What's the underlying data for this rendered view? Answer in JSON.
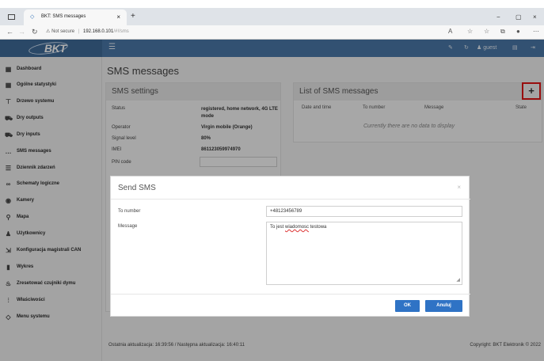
{
  "browser": {
    "tab_title": "BKT: SMS messages",
    "tab_close": "×",
    "new_tab": "+",
    "window_minimize": "−",
    "window_maximize": "▢",
    "window_close": "×",
    "not_secure_label": "Not secure",
    "url_host": "192.168.0.101",
    "url_path": "/#!/sms",
    "url_separator": "|"
  },
  "app": {
    "logo_text": "BKT",
    "user_label": "guest",
    "menu_icon": "☰"
  },
  "sidebar": {
    "items": [
      {
        "label": "Dashboard",
        "icon": "grid-icon"
      },
      {
        "label": "Ogólne statystyki",
        "icon": "grid-icon"
      },
      {
        "label": "Drzewo systemu",
        "icon": "tree-icon"
      },
      {
        "label": "Dry outputs",
        "icon": "car-icon"
      },
      {
        "label": "Dry inputs",
        "icon": "car-icon"
      },
      {
        "label": "SMS messages",
        "icon": "dots-icon"
      },
      {
        "label": "Dziennik zdarzeń",
        "icon": "list-icon"
      },
      {
        "label": "Schematy logiczne",
        "icon": "link-icon"
      },
      {
        "label": "Kamery",
        "icon": "eye-icon"
      },
      {
        "label": "Mapa",
        "icon": "pin-icon"
      },
      {
        "label": "Użytkownicy",
        "icon": "users-icon"
      },
      {
        "label": "Konfiguracja magistrali CAN",
        "icon": "login-icon"
      },
      {
        "label": "Wykres",
        "icon": "chart-icon"
      },
      {
        "label": "Zresetować czujniki dymu",
        "icon": "fire-icon"
      },
      {
        "label": "Właściwości",
        "icon": "sliders-icon"
      },
      {
        "label": "Menu systemu",
        "icon": "logo-icon"
      }
    ]
  },
  "main": {
    "page_title": "SMS messages",
    "settings": {
      "title": "SMS settings",
      "rows": [
        {
          "label": "Status",
          "value": "registered, home network, 4G LTE mode"
        },
        {
          "label": "Operator",
          "value": "Virgin mobile (Orange)"
        },
        {
          "label": "Signal level",
          "value": "80%"
        },
        {
          "label": "IMEI",
          "value": "861123059974970"
        },
        {
          "label": "PIN code",
          "value": ""
        }
      ]
    },
    "list": {
      "title": "List of SMS messages",
      "columns": [
        "Date and time",
        "To number",
        "Message",
        "State"
      ],
      "empty_text": "Currently there are no data to display",
      "add_button": "+"
    },
    "footer": {
      "left": "Ostatnia aktualizacja: 16:39:56 / Następna aktualizacja: 16:40:11",
      "right": "Copyright: BKT Elektronik © 2022"
    }
  },
  "modal": {
    "title": "Send SMS",
    "close": "×",
    "to_label": "To number",
    "to_value": "+48123456789",
    "message_label": "Message",
    "message_before": "To jest ",
    "message_misspelled": "wiadomosc",
    "message_after": " testowa",
    "ok_label": "OK",
    "cancel_label": "Anuluj"
  },
  "colors": {
    "accent": "#2f73c5",
    "topbar": "#4a78a8",
    "highlight": "#e01515"
  }
}
